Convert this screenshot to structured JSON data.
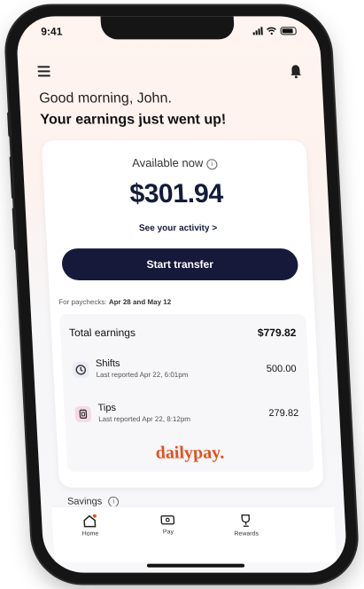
{
  "status": {
    "time": "9:41"
  },
  "header": {
    "greeting": "Good morning, John.",
    "subtitle": "Your earnings just went up!"
  },
  "balance": {
    "label": "Available now",
    "amount": "$301.94",
    "activity_link": "See your activity >",
    "transfer_button": "Start transfer"
  },
  "paychecks": {
    "label": "For paychecks:",
    "dates": "Apr 28 and May 12"
  },
  "earnings": {
    "total_label": "Total earnings",
    "total_value": "$779.82",
    "items": [
      {
        "title": "Shifts",
        "subtitle": "Last reported Apr 22, 6:01pm",
        "amount": "500.00",
        "icon": "clock-icon"
      },
      {
        "title": "Tips",
        "subtitle": "Last reported Apr 22, 8:12pm",
        "amount": "279.82",
        "icon": "tips-icon"
      }
    ]
  },
  "brand": {
    "name": "dailypay.",
    "color": "#e4511e"
  },
  "savings": {
    "label": "Savings"
  },
  "tabs": [
    {
      "label": "Home",
      "icon": "home-icon"
    },
    {
      "label": "Pay",
      "icon": "pay-icon"
    },
    {
      "label": "Rewards",
      "icon": "trophy-icon"
    }
  ],
  "colors": {
    "accent": "#16193a",
    "brand": "#e4511e"
  }
}
